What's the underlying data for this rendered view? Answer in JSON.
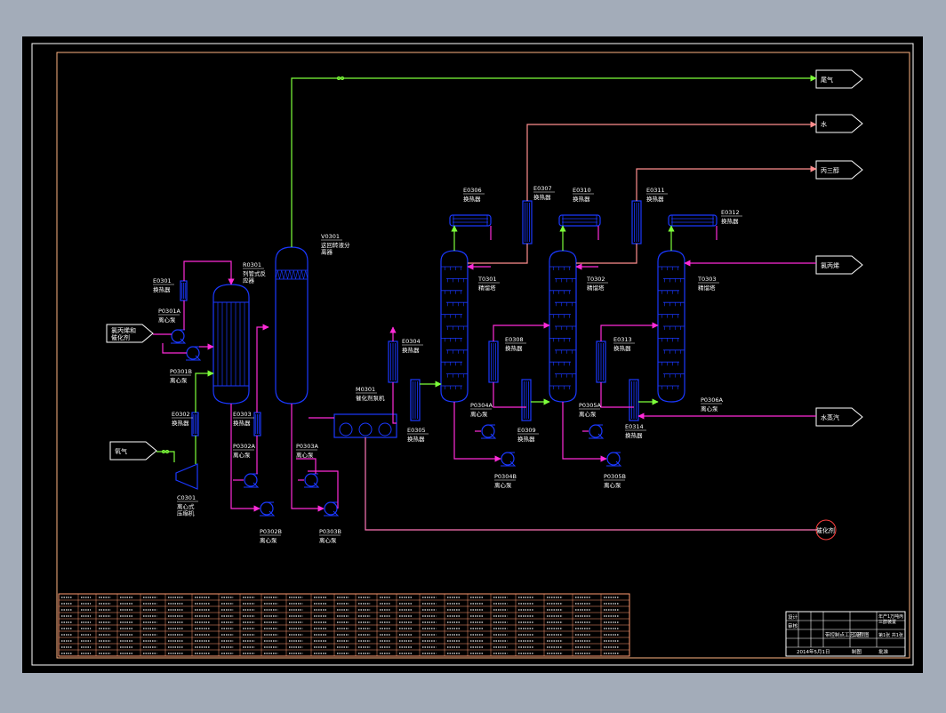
{
  "colors": {
    "background": "#a3acb9",
    "canvas": "#000000",
    "frame": "#ffffff",
    "border": "#ffb482",
    "equipment": "#1a38ff",
    "gas_line": "#7dff3a",
    "process_line": "#ff2bd8",
    "overhead_line": "#ff8e8e",
    "feed_line": "#ff76b8",
    "label": "#ffffff",
    "table_line": "#ff9a70",
    "stream_box": "#ffffff",
    "waste_circle": "#ff4040"
  },
  "streams": {
    "out_gas": "尾气",
    "out_water": "水",
    "out_propylene": "丙三醇",
    "in_reflux": "氯丙烯",
    "in_feed": "氯丙烯和\n催化剂",
    "in_air": "氧气",
    "in_steam": "水蒸汽",
    "out_waste": "催化剂"
  },
  "equipment": [
    {
      "tag": "E0301",
      "name": "换热器"
    },
    {
      "tag": "P0301A",
      "name": "离心泵"
    },
    {
      "tag": "P0301B",
      "name": "离心泵"
    },
    {
      "tag": "R0301",
      "name": "列管式反\n应器"
    },
    {
      "tag": "V0301",
      "name": "这回转液分\n离器"
    },
    {
      "tag": "E0302",
      "name": "换热器"
    },
    {
      "tag": "C0301",
      "name": "离心式\n压缩机"
    },
    {
      "tag": "E0303",
      "name": "换热器"
    },
    {
      "tag": "P0302A",
      "name": "离心泵"
    },
    {
      "tag": "P0302B",
      "name": "离心泵"
    },
    {
      "tag": "P0303A",
      "name": "离心泵"
    },
    {
      "tag": "P0303B",
      "name": "离心泵"
    },
    {
      "tag": "M0301",
      "name": "催化剂泵机"
    },
    {
      "tag": "E0304",
      "name": "换热器"
    },
    {
      "tag": "E0305",
      "name": "换热器"
    },
    {
      "tag": "E0306",
      "name": "换热器"
    },
    {
      "tag": "E0307",
      "name": "换热器"
    },
    {
      "tag": "T0301",
      "name": "精馏塔"
    },
    {
      "tag": "P0304A",
      "name": "离心泵"
    },
    {
      "tag": "P0304B",
      "name": "离心泵"
    },
    {
      "tag": "E0308",
      "name": "换热器"
    },
    {
      "tag": "E0309",
      "name": "换热器"
    },
    {
      "tag": "E0310",
      "name": "换热器"
    },
    {
      "tag": "T0302",
      "name": "精馏塔"
    },
    {
      "tag": "P0305A",
      "name": "离心泵"
    },
    {
      "tag": "P0305B",
      "name": "离心泵"
    },
    {
      "tag": "E0311",
      "name": "换热器"
    },
    {
      "tag": "E0312",
      "name": "换热器"
    },
    {
      "tag": "E0313",
      "name": "换热器"
    },
    {
      "tag": "E0314",
      "name": "换热器"
    },
    {
      "tag": "T0303",
      "name": "精馏塔"
    },
    {
      "tag": "P0306A",
      "name": "离心泵"
    }
  ],
  "title_block": {
    "designer": "设计",
    "checker": "审核",
    "drawing_title": "带控制点工艺流程图",
    "project": "年产1万吨丙\n三醇装置",
    "sheet": "工艺",
    "scale": "第1张 共1张",
    "date": "2014年5月1日",
    "drawn": "制图",
    "approved": "批准"
  }
}
